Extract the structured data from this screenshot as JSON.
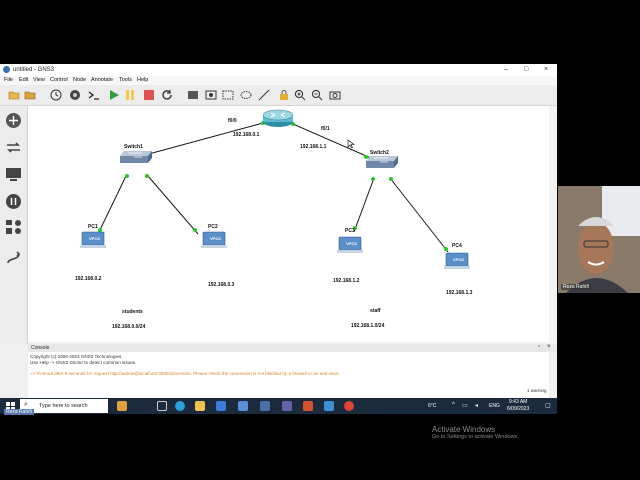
{
  "window": {
    "title": "untitled - GNS3"
  },
  "menu": [
    "File",
    "Edit",
    "View",
    "Control",
    "Node",
    "Annotate",
    "Tools",
    "Help"
  ],
  "toolbar_icons": [
    "folder-icon",
    "open-icon",
    "clock-icon",
    "terminal-icon",
    "prompt-icon",
    "start-icon",
    "pause-icon",
    "stop-icon",
    "reload-icon",
    "note-icon",
    "image-icon",
    "rectangle-icon",
    "ellipse-icon",
    "line-icon",
    "lock-icon",
    "zoom-in-icon",
    "zoom-out-icon",
    "camera-icon"
  ],
  "sidebar_icons": [
    "router-browse-icon",
    "switch-browse-icon",
    "end-device-icon",
    "security-icon",
    "all-devices-icon",
    "link-icon"
  ],
  "topology": {
    "interfaces": {
      "f0_0": "f0/0",
      "f0_1": "f0/1"
    },
    "router_ip_left": "192.168.0.1",
    "router_ip_right": "192.168.1.1",
    "switch1": "Switch1",
    "switch2": "Switch2",
    "pc1": {
      "name": "PC1",
      "ip": "192.168.0.2"
    },
    "pc2": {
      "name": "PC2",
      "ip": "192.168.0.3"
    },
    "pc3": {
      "name": "PC3",
      "ip": "192.168.1.2"
    },
    "pc4": {
      "name": "PC4",
      "ip": "192.168.1.3"
    },
    "vpcs_label": "VPCS",
    "group_left": {
      "name": "students",
      "net": "192.168.0.0/24"
    },
    "group_right": {
      "name": "staff",
      "net": "192.168.1.0/24"
    }
  },
  "console": {
    "header": "Console",
    "line1": "Copyright (c) 2006-2023 GNS3 Technologies.",
    "line2": "Use Help -> GNS3 Doctor to detect common issues.",
    "line3": "=> Timeout after 5 seconds for request http://admin@localhost:3080/v2/version. Please check the connection is not blocked by a firewall or an anti-virus."
  },
  "activation": {
    "title": "Activate Windows",
    "subtitle": "Go to Settings to activate Windows."
  },
  "taskbar": {
    "search_placeholder": "Type here to search",
    "weather": "6°C",
    "language": "ENG",
    "time": "9:43 AM",
    "date": "6/09/2023",
    "notification": "1 warning"
  },
  "webcam": {
    "name": "Reza Rahifi"
  },
  "overlay_name": "Reza Rahifi",
  "colors": {
    "link": "#1a1a1a",
    "port_up": "#22cc22",
    "vpcs": "#5a8fc8",
    "taskbar": "#1c2a3e"
  }
}
